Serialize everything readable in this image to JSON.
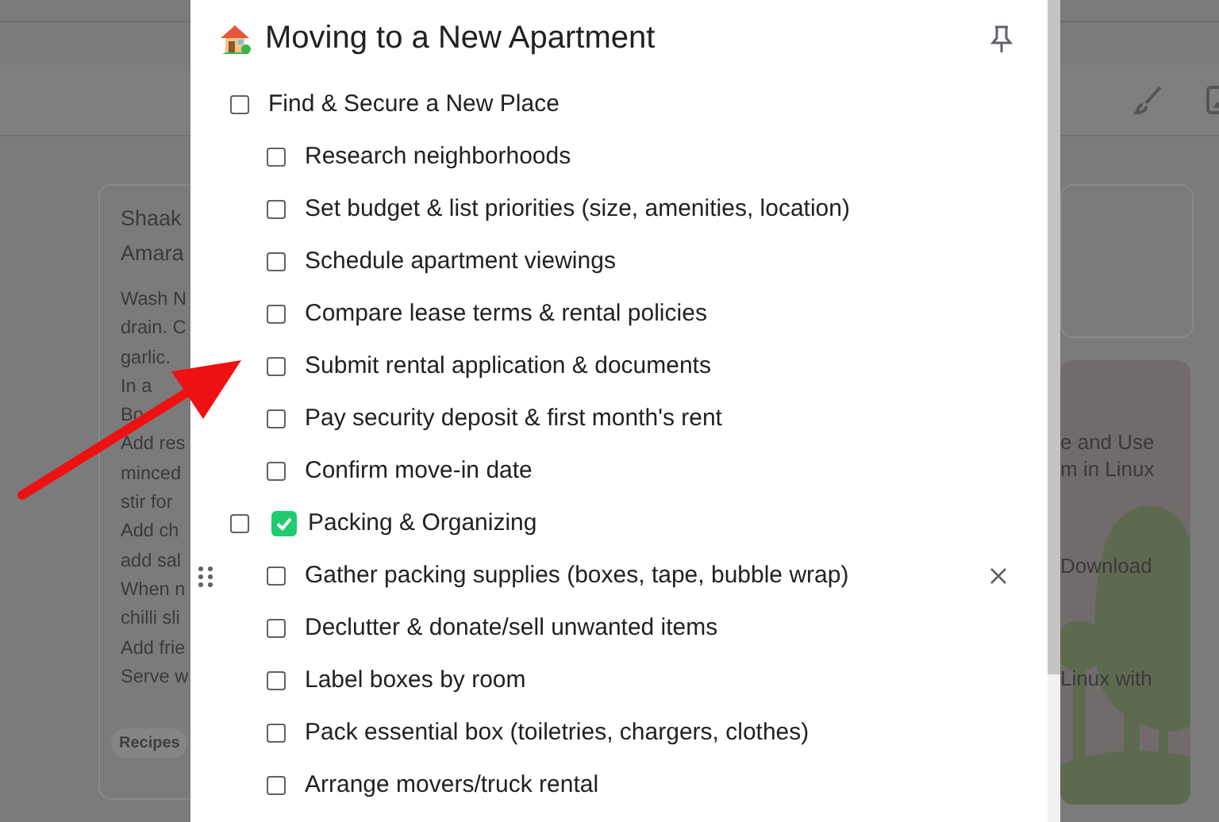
{
  "background": {
    "cards": [
      {
        "title_lines": [
          "Shaak",
          "Amara"
        ],
        "body_lines": [
          "Wash N",
          "drain. C",
          "garlic.",
          "In a",
          "Bo",
          "Add res",
          "minced",
          "stir for",
          "Add ch",
          "add sal",
          "When n",
          "chilli sli",
          "Add frie",
          "Serve w"
        ],
        "label": "Recipes"
      },
      {
        "lines": [
          "e and Use",
          "m in Linux",
          "Download",
          "Linux with"
        ]
      }
    ]
  },
  "note": {
    "title": "Moving to a New Apartment",
    "pinned": false,
    "items": [
      {
        "kind": "plain",
        "text": "Find & Secure a New Place",
        "checked": false,
        "hovered": false,
        "children": [
          {
            "text": "Research neighborhoods",
            "checked": false,
            "hovered": false
          },
          {
            "text": "Set budget & list priorities (size, amenities, location)",
            "checked": false,
            "hovered": false
          },
          {
            "text": "Schedule apartment viewings",
            "checked": false,
            "hovered": false
          },
          {
            "text": "Compare lease terms & rental policies",
            "checked": false,
            "hovered": false
          },
          {
            "text": "Submit rental application & documents",
            "checked": false,
            "hovered": false
          },
          {
            "text": "Pay security deposit & first month's rent",
            "checked": false,
            "hovered": false
          },
          {
            "text": "Confirm move-in date",
            "checked": false,
            "hovered": false
          }
        ]
      },
      {
        "kind": "check-mark",
        "text": "Packing & Organizing",
        "checked": false,
        "hovered": false,
        "children": [
          {
            "text": "Gather packing supplies (boxes, tape, bubble wrap)",
            "checked": false,
            "hovered": true
          },
          {
            "text": "Declutter & donate/sell unwanted items",
            "checked": false,
            "hovered": false
          },
          {
            "text": "Label boxes by room",
            "checked": false,
            "hovered": false
          },
          {
            "text": "Pack essential box (toiletries, chargers, clothes)",
            "checked": false,
            "hovered": false
          },
          {
            "text": "Arrange movers/truck rental",
            "checked": false,
            "hovered": false
          }
        ]
      }
    ]
  }
}
